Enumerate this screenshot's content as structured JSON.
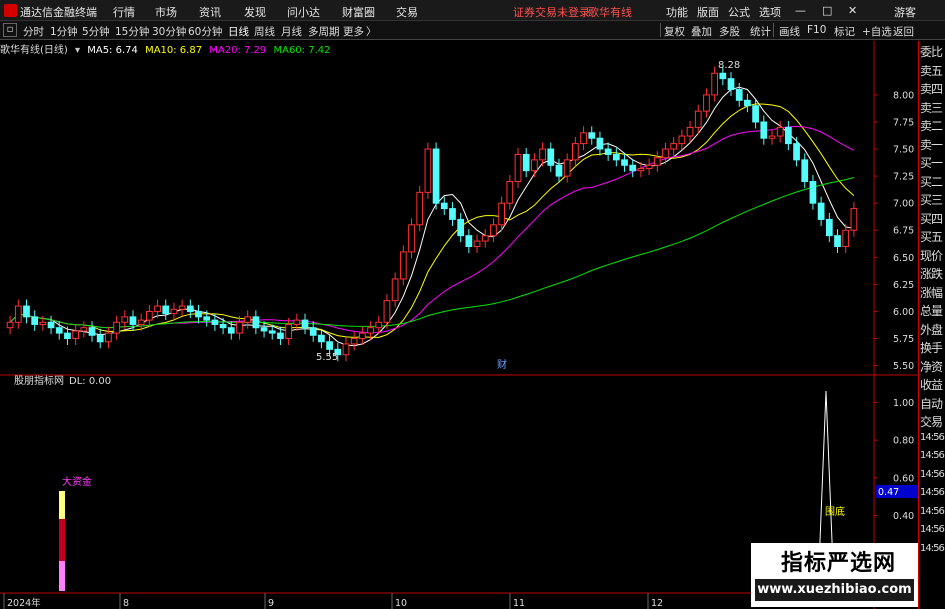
{
  "menubar": {
    "app_title": "通达信金融终端",
    "menus": [
      "行情",
      "市场",
      "资讯",
      "发现",
      "问小达",
      "财富圈",
      "交易"
    ],
    "status_text": "证券交易未登录",
    "stock_name": "歌华有线",
    "right_menus": [
      "功能",
      "版面",
      "公式",
      "选项"
    ],
    "window_controls": [
      "minimize-icon",
      "maximize-icon",
      "close-icon"
    ],
    "guest_label": "游客"
  },
  "toolbar": {
    "periods": [
      "分时",
      "1分钟",
      "5分钟",
      "15分钟",
      "30分钟",
      "60分钟",
      "日线",
      "周线",
      "月线",
      "多周期",
      "更多"
    ],
    "active_period": "日线",
    "more_arrow": "〉",
    "right_tools": [
      "复权",
      "叠加",
      "多股",
      "统计",
      "画线",
      "F10",
      "标记",
      "+自选",
      "返回"
    ]
  },
  "price_header": {
    "title": "歌华有线(日线)",
    "ma5": "MA5: 6.74",
    "ma10": "MA10: 6.87",
    "ma20": "MA20: 7.29",
    "ma60": "MA60: 7.42"
  },
  "indicator_header": {
    "title": "股朋指标网",
    "dl": "DL: 0.00"
  },
  "annotations": {
    "high_label": "8.28",
    "low_label": "5.55",
    "finance_marker": "财",
    "big_money_label": "大资金",
    "bottom_label": "围底",
    "current_value": "0.47"
  },
  "colors": {
    "up": "#ff3232",
    "down": "#54fcfc",
    "ma5": "#ffffff",
    "ma10": "#ffff00",
    "ma20": "#ff00ff",
    "ma60": "#00e600",
    "axis_red": "#c00000",
    "accent_blue": "#0000cc"
  },
  "chart_data": [
    {
      "type": "candlestick",
      "title": "歌华有线(日线)",
      "ylim": [
        5.45,
        8.35
      ],
      "y_ticks": [
        "8.00",
        "7.75",
        "7.50",
        "7.25",
        "7.00",
        "6.75",
        "6.50",
        "6.25",
        "6.00",
        "5.75",
        "5.50"
      ],
      "x_ticks": [
        "2024年",
        "8",
        "9",
        "10",
        "11",
        "12"
      ],
      "series": [
        {
          "name": "K线",
          "close": [
            5.9,
            6.05,
            5.95,
            5.88,
            5.9,
            5.85,
            5.8,
            5.75,
            5.82,
            5.85,
            5.78,
            5.72,
            5.8,
            5.9,
            5.95,
            5.88,
            5.92,
            6.0,
            6.05,
            5.98,
            6.02,
            6.05,
            6.0,
            5.95,
            5.92,
            5.88,
            5.85,
            5.8,
            5.9,
            5.95,
            5.85,
            5.82,
            5.8,
            5.75,
            5.88,
            5.92,
            5.85,
            5.78,
            5.72,
            5.65,
            5.6,
            5.7,
            5.75,
            5.8,
            5.85,
            5.9,
            6.1,
            6.3,
            6.55,
            6.8,
            7.1,
            7.5,
            7.0,
            6.95,
            6.85,
            6.7,
            6.6,
            6.65,
            6.7,
            6.8,
            7.0,
            7.2,
            7.45,
            7.3,
            7.4,
            7.5,
            7.35,
            7.25,
            7.4,
            7.55,
            7.65,
            7.6,
            7.5,
            7.45,
            7.4,
            7.35,
            7.3,
            7.32,
            7.35,
            7.42,
            7.5,
            7.55,
            7.62,
            7.7,
            7.85,
            8.0,
            8.2,
            8.15,
            8.05,
            7.95,
            7.9,
            7.75,
            7.6,
            7.62,
            7.7,
            7.55,
            7.4,
            7.2,
            7.0,
            6.85,
            6.7,
            6.6,
            6.75,
            6.95
          ]
        },
        {
          "name": "MA5",
          "value": 6.74
        },
        {
          "name": "MA10",
          "value": 6.87
        },
        {
          "name": "MA20",
          "value": 7.29
        },
        {
          "name": "MA60",
          "value": 7.42
        }
      ]
    },
    {
      "type": "bar",
      "title": "股朋指标网",
      "ylim": [
        0,
        1.05
      ],
      "y_ticks": [
        "1.00",
        "0.80",
        "0.60",
        "0.40"
      ],
      "series": [
        {
          "name": "DL",
          "values": [
            0.0
          ]
        }
      ],
      "annotations": [
        "大资金",
        "围底"
      ]
    }
  ],
  "right_panel": {
    "items": [
      "委比",
      "卖五",
      "卖四",
      "卖三",
      "卖二",
      "卖一",
      "买一",
      "买二",
      "买三",
      "买四",
      "买五",
      "现价",
      "涨跌",
      "涨幅",
      "总量",
      "外盘",
      "换手",
      "净资",
      "收益",
      "自动",
      "交易",
      "14:56",
      "14:56",
      "14:56",
      "14:56",
      "14:56",
      "14:56",
      "14:56"
    ]
  },
  "watermark": {
    "title": "指标严选网",
    "url": "www.xuezhibiao.com"
  }
}
